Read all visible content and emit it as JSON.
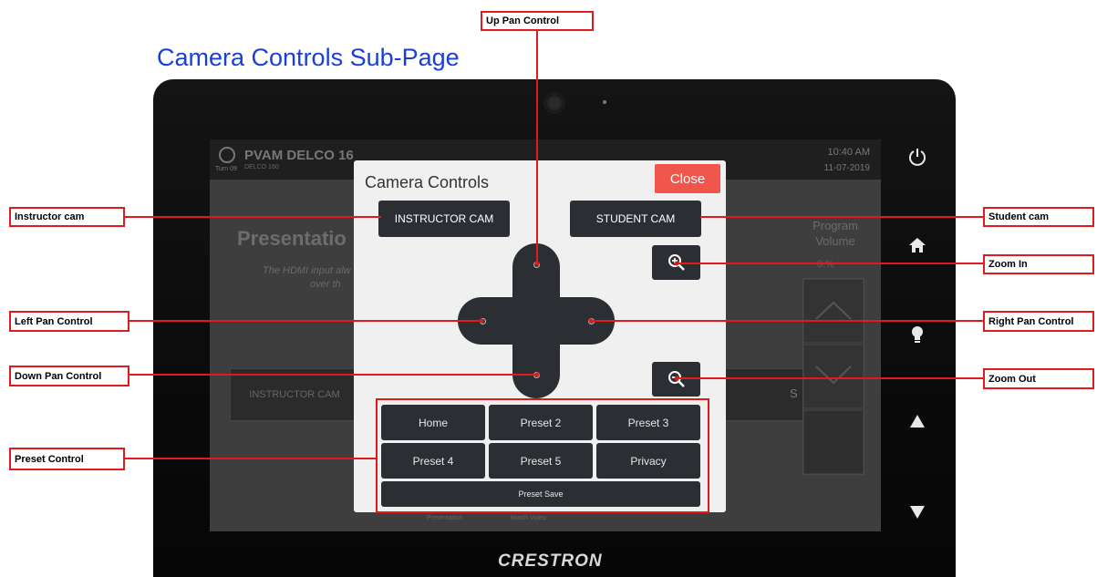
{
  "page_title": "Camera Controls Sub-Page",
  "device": {
    "brand": "CRESTRON",
    "background_ui": {
      "room_name": "PVAM DELCO 16",
      "room_sub": "DELCO 160",
      "turn_label": "Turn 09",
      "time": "10:40 AM",
      "date": "11-07-2019",
      "presentation_title": "Presentatio",
      "hdmi_text": "The HDMI input alw",
      "over_text": "over th",
      "instructor_cam_bg": "INSTRUCTOR CAM",
      "program_volume": "Program Volume",
      "volume_pct": "0 %",
      "s_label": "S",
      "bottom_left": "Presentation",
      "bottom_right": "Match Video"
    },
    "side_icons": [
      "power-icon",
      "home-icon",
      "lightbulb-icon",
      "up-arrow-icon",
      "down-arrow-icon"
    ]
  },
  "dialog": {
    "title": "Camera Controls",
    "close_label": "Close",
    "instructor_cam_label": "INSTRUCTOR CAM",
    "student_cam_label": "STUDENT CAM",
    "zoom_in_glyph": "⊕",
    "zoom_out_glyph": "⊖",
    "presets": [
      "Home",
      "Preset 2",
      "Preset 3",
      "Preset 4",
      "Preset 5",
      "Privacy"
    ],
    "preset_save_label": "Preset Save"
  },
  "callouts": {
    "up_pan": "Up Pan Control",
    "instructor_cam": "Instructor cam",
    "student_cam": "Student cam",
    "zoom_in": "Zoom In",
    "left_pan": "Left Pan Control",
    "right_pan": "Right Pan Control",
    "down_pan": "Down Pan Control",
    "zoom_out": "Zoom Out",
    "preset_control": "Preset Control"
  },
  "colors": {
    "callout_red": "#e01b1b",
    "title_blue": "#1a3fd6",
    "close_red": "#f0564b",
    "button_dark": "#2b2f33"
  }
}
